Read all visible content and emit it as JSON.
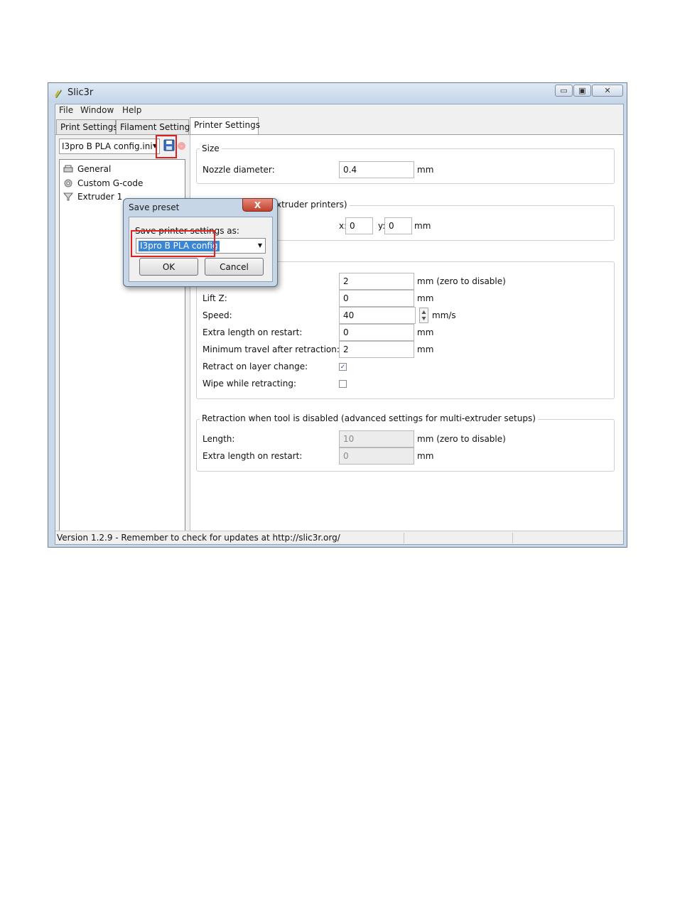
{
  "window": {
    "title": "Slic3r",
    "minimize_label": "▭",
    "maximize_label": "▣",
    "close_label": "✕"
  },
  "menu": {
    "items": [
      "File",
      "Window",
      "Help"
    ]
  },
  "tabs": [
    {
      "label": "Print Settings"
    },
    {
      "label": "Filament Settings"
    },
    {
      "label": "Printer Settings"
    }
  ],
  "preset": {
    "selected": "I3pro B PLA config.ini"
  },
  "tree": {
    "items": [
      {
        "label": "General",
        "icon": "printer-icon"
      },
      {
        "label": "Custom G-code",
        "icon": "gear-icon"
      },
      {
        "label": "Extruder 1",
        "icon": "funnel-icon"
      }
    ]
  },
  "size_group": {
    "title": "Size",
    "nozzle_label": "Nozzle diameter:",
    "nozzle_value": "0.4",
    "nozzle_unit": "mm"
  },
  "position_group": {
    "title_visible": "xtruder printers)",
    "x_label": "x:",
    "x_value": "0",
    "y_label": "y:",
    "y_value": "0",
    "unit": "mm"
  },
  "retraction_group": {
    "length_value": "2",
    "length_unit": "mm (zero to disable)",
    "lift_label": "Lift Z:",
    "lift_value": "0",
    "lift_unit": "mm",
    "speed_label": "Speed:",
    "speed_value": "40",
    "speed_unit": "mm/s",
    "extra_label": "Extra length on restart:",
    "extra_value": "0",
    "extra_unit": "mm",
    "min_travel_label": "Minimum travel after retraction:",
    "min_travel_value": "2",
    "min_travel_unit": "mm",
    "layer_change_label": "Retract on layer change:",
    "layer_change_checked": true,
    "wipe_label": "Wipe while retracting:",
    "wipe_checked": false
  },
  "tool_disabled_group": {
    "title": "Retraction when tool is disabled (advanced settings for multi-extruder setups)",
    "length_label": "Length:",
    "length_value": "10",
    "length_unit": "mm (zero to disable)",
    "extra_label": "Extra length on restart:",
    "extra_value": "0",
    "extra_unit": "mm"
  },
  "status": {
    "text": "Version 1.2.9 - Remember to check for updates at http://slic3r.org/"
  },
  "dialog": {
    "title": "Save preset",
    "close_label": "X",
    "label": "Save printer settings as:",
    "value": "I3pro B PLA config",
    "ok_label": "OK",
    "cancel_label": "Cancel"
  },
  "colors": {
    "highlight": "#e02020",
    "selection": "#3a86d4",
    "window_frame": "#c9d9ea"
  }
}
